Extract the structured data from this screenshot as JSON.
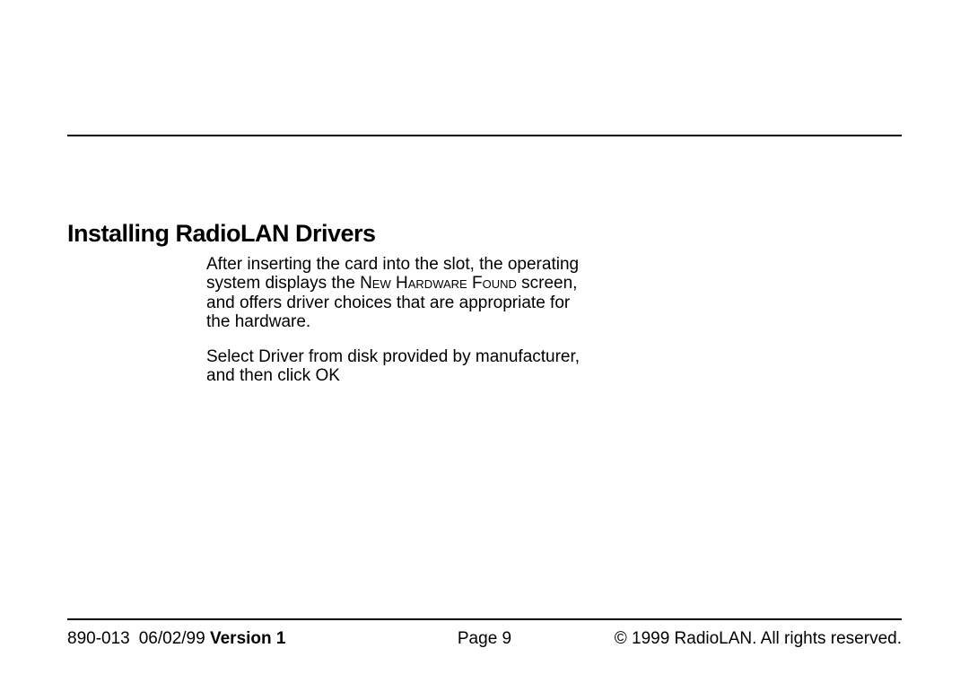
{
  "heading": "Installing RadioLAN Drivers",
  "paragraph1_part1": "After inserting the card into the slot, the operating system displays the ",
  "paragraph1_caps1": "New Hardware Found",
  "paragraph1_part2": " screen, and offers driver choices that are appropriate for the hardware.",
  "paragraph2": "Select Driver from disk provided by manufacturer, and then click OK",
  "footer": {
    "doc_number": "890-013",
    "date": "06/02/99",
    "version_label": "Version 1",
    "page_label": "Page 9",
    "copyright": "© 1999 RadioLAN. All rights reserved."
  }
}
